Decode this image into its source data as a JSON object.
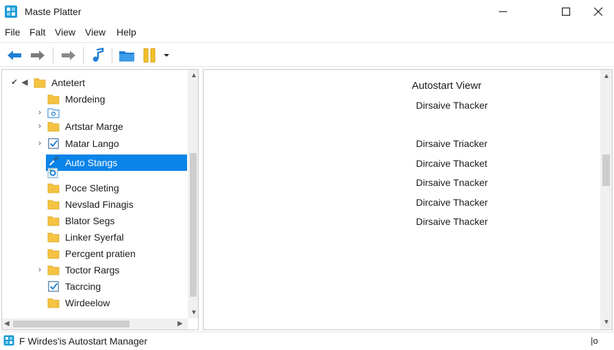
{
  "window": {
    "title": "Maste Platter",
    "app_icon": "app-tile-icon",
    "controls": [
      "minimize-icon",
      "maximize-icon",
      "close-icon"
    ]
  },
  "menu": [
    "File",
    "Falt",
    "View",
    "View",
    "Help"
  ],
  "toolbar": {
    "buttons": [
      "back-arrow-icon",
      "forward-arrow-icon",
      "redo-arrow-icon",
      "music-note-icon",
      "folder-icon",
      "pause-icon",
      "dropdown-caret-icon"
    ]
  },
  "tree": {
    "root": "Antetert",
    "items": [
      {
        "label": "Mordeing",
        "icon": "folder-icon",
        "expander": ""
      },
      {
        "label": "",
        "icon": "folder-search-icon",
        "expander": ">"
      },
      {
        "label": "Artstar Marge",
        "icon": "folder-icon",
        "expander": ">"
      },
      {
        "label": "Matar Lango",
        "icon": "checkbox-icon",
        "expander": ">"
      },
      {
        "label": "Auto Stangs",
        "icon": "wrench-icon",
        "expander": "",
        "selected": true
      },
      {
        "label": "",
        "icon": "gear-icon",
        "expander": ""
      },
      {
        "label": "Poce Sleting",
        "icon": "folder-icon",
        "expander": ""
      },
      {
        "label": "Nevslad Finagis",
        "icon": "folder-icon",
        "expander": ""
      },
      {
        "label": "Blator Segs",
        "icon": "folder-icon",
        "expander": ""
      },
      {
        "label": "Linker Syerfal",
        "icon": "folder-icon",
        "expander": ""
      },
      {
        "label": "Percgent pratien",
        "icon": "folder-icon",
        "expander": ""
      },
      {
        "label": "Toctor Rargs",
        "icon": "folder-icon",
        "expander": ">"
      },
      {
        "label": "Tacrcing",
        "icon": "checkbox-icon",
        "expander": ""
      },
      {
        "label": "Wirdeelow",
        "icon": "folder-icon",
        "expander": ""
      }
    ]
  },
  "right_panel": {
    "title": "Autostart Viewr",
    "items": [
      "Dirsaive Thacker",
      "Dirsaive Triacker",
      "Dircaive Thacket",
      "Dirsaive Tnacker",
      "Dircaive Thacker",
      "Dirsaive Thacker"
    ]
  },
  "status": {
    "text": "F Wirdes'is Autostart Manager",
    "right": "|o"
  },
  "colors": {
    "selection": "#0a84e8",
    "folder": "#f5c342",
    "accent_blue": "#1e7fd6"
  }
}
